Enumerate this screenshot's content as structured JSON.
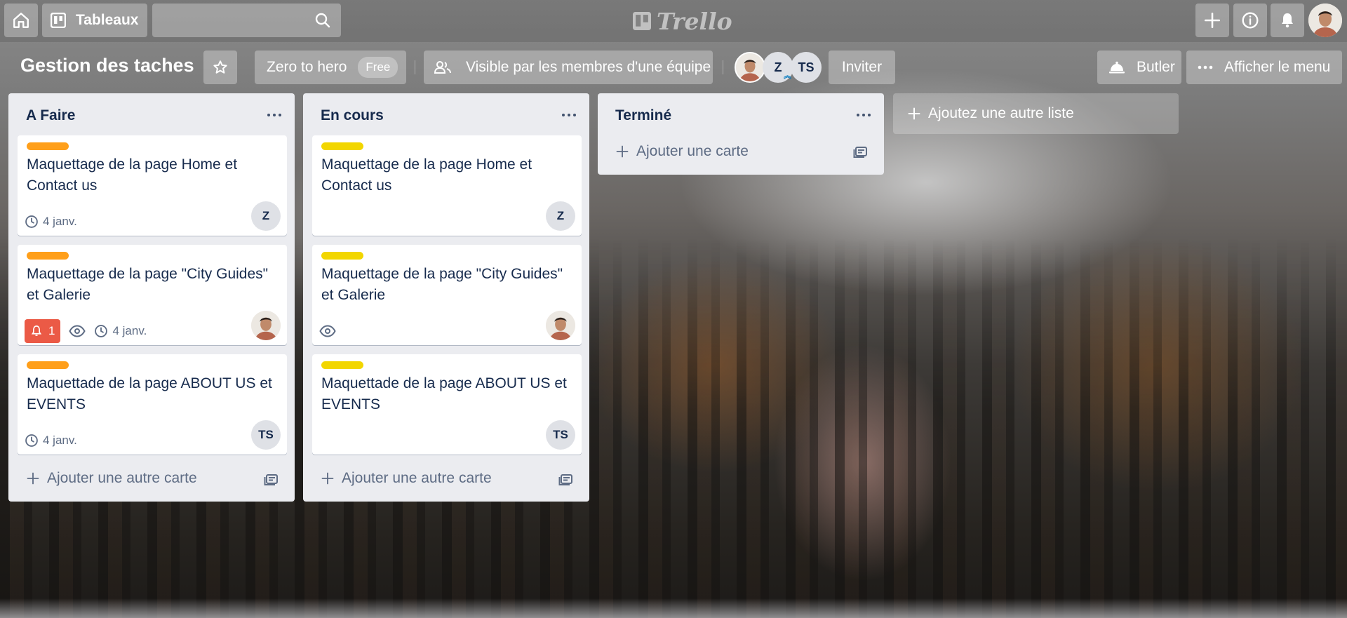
{
  "header": {
    "boards_label": "Tableaux",
    "search_placeholder": "",
    "logo_text": "Trello"
  },
  "board": {
    "title": "Gestion des taches",
    "team_name": "Zero to hero",
    "team_plan": "Free",
    "visibility": "Visible par les membres d'une équipe",
    "members": [
      "Z",
      "TS"
    ],
    "invite_label": "Inviter",
    "butler_label": "Butler",
    "menu_label": "Afficher le menu"
  },
  "colors": {
    "orange_label": "#ff9f1a",
    "yellow_label": "#f2d600",
    "notification_red": "#eb5a46",
    "list_bg": "#ebecf0"
  },
  "lists": [
    {
      "title": "A Faire",
      "add_card_label": "Ajouter une autre carte",
      "cards": [
        {
          "label_color": "orange",
          "title": "Maquettage de la page Home et Contact us",
          "due": "4 janv.",
          "member": "Z"
        },
        {
          "label_color": "orange",
          "title": "Maquettage de la page \"City Guides\" et Galerie",
          "notifications": "1",
          "watching": true,
          "due": "4 janv.",
          "member": "photo"
        },
        {
          "label_color": "orange",
          "title": "Maquettade de la page ABOUT US et EVENTS",
          "due": "4 janv.",
          "member": "TS"
        }
      ]
    },
    {
      "title": "En cours",
      "add_card_label": "Ajouter une autre carte",
      "cards": [
        {
          "label_color": "yellow",
          "title": "Maquettage de la page Home et Contact us",
          "member": "Z"
        },
        {
          "label_color": "yellow",
          "title": "Maquettage de la page \"City Guides\" et Galerie",
          "watching": true,
          "member": "photo"
        },
        {
          "label_color": "yellow",
          "title": "Maquettade de la page ABOUT US et EVENTS",
          "member": "TS"
        }
      ]
    },
    {
      "title": "Terminé",
      "add_card_label": "Ajouter une carte",
      "cards": []
    }
  ],
  "add_list_label": "Ajoutez une autre liste",
  "icons": [
    "home-icon",
    "board-icon",
    "search-icon",
    "trello-logo-icon",
    "plus-icon",
    "info-icon",
    "bell-icon",
    "star-icon",
    "team-visibility-icon",
    "butler-icon",
    "more-icon",
    "clock-icon",
    "eye-icon",
    "template-icon"
  ]
}
